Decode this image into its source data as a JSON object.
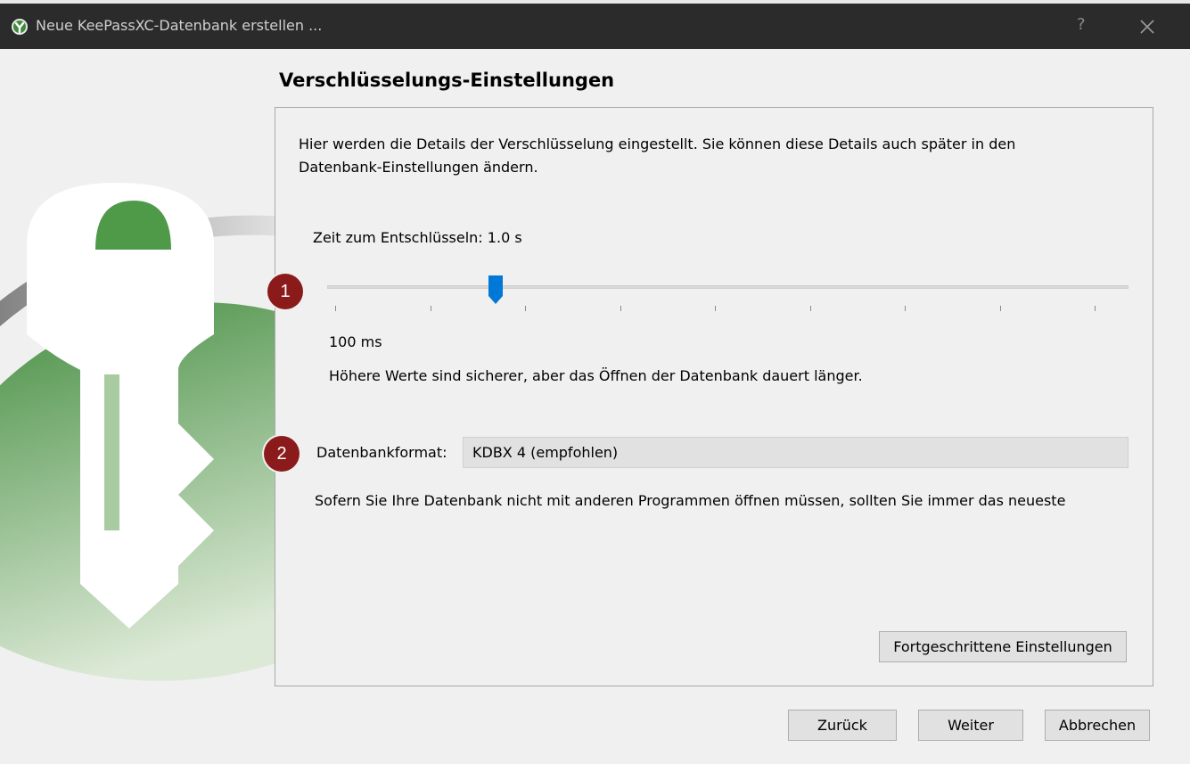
{
  "window": {
    "title": "Neue KeePassXC-Datenbank erstellen ...",
    "help_label": "?"
  },
  "page": {
    "heading": "Verschlüsselungs-Einstellungen",
    "intro": "Hier werden die Details der Verschlüsselung eingestellt. Sie können diese Details auch später in den Datenbank-Einstellungen ändern.",
    "decrypt_time_label": "Zeit zum Entschlüsseln:",
    "decrypt_time_value": "1.0 s",
    "slider_min_label": "100 ms",
    "slider_level": 0.21,
    "hint": "Höhere Werte sind sicherer, aber das Öffnen der Datenbank dauert länger.",
    "format_label": "Datenbankformat:",
    "format_value": "KDBX 4 (empfohlen)",
    "format_hint": "Sofern Sie Ihre Datenbank nicht mit anderen Programmen öffnen müssen, sollten Sie immer das neueste",
    "advanced_button": "Fortgeschrittene Einstellungen"
  },
  "badges": [
    "1",
    "2"
  ],
  "footer": {
    "back_button": "Zurück",
    "next_button": "Weiter",
    "cancel_button": "Abbrechen"
  },
  "colors": {
    "titlebar": "#2b2b2b",
    "badge": "#8b1a1a",
    "slider_handle": "#0078d7",
    "logo_green": "#4e9a49"
  }
}
